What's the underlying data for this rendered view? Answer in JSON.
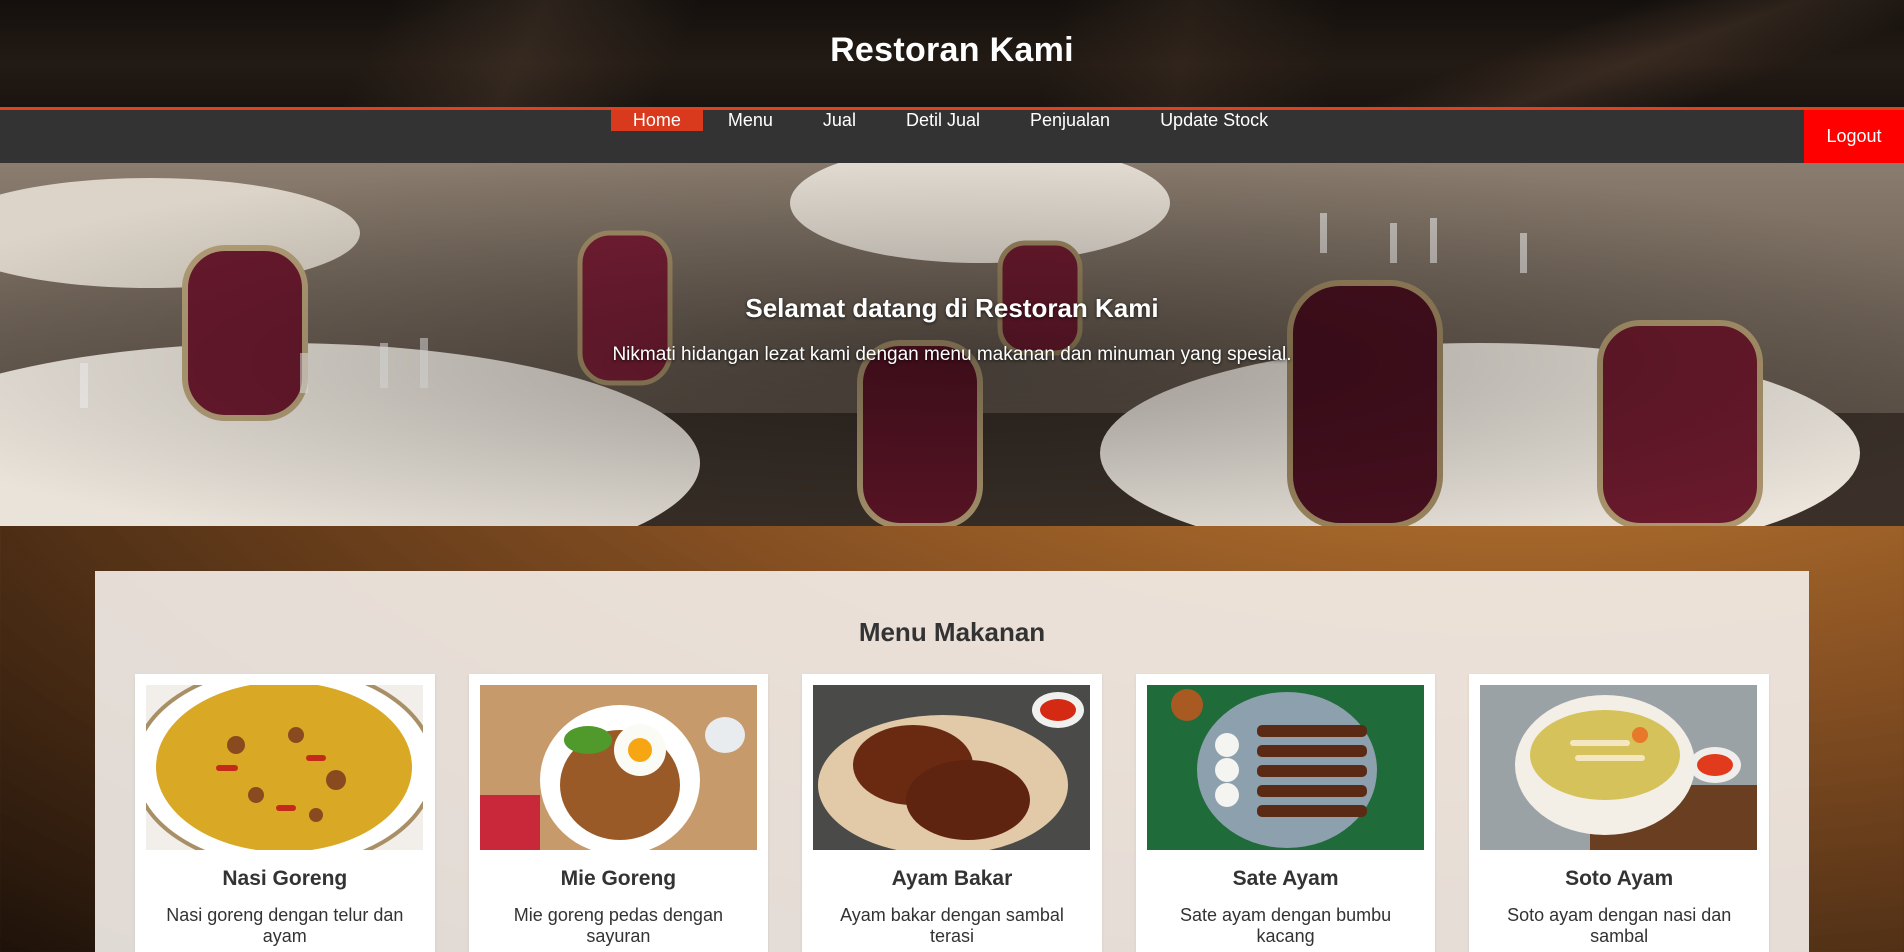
{
  "site": {
    "title": "Restoran Kami"
  },
  "nav": {
    "items": [
      {
        "label": "Home",
        "active": true
      },
      {
        "label": "Menu"
      },
      {
        "label": "Jual"
      },
      {
        "label": "Detil Jual"
      },
      {
        "label": "Penjualan"
      },
      {
        "label": "Update Stock"
      }
    ],
    "logout_label": "Logout"
  },
  "hero": {
    "title": "Selamat datang di Restoran Kami",
    "subtitle": "Nikmati hidangan lezat kami dengan menu makanan dan minuman yang spesial."
  },
  "menu": {
    "title": "Menu Makanan",
    "items": [
      {
        "name": "Nasi Goreng",
        "desc": "Nasi goreng dengan telur dan ayam"
      },
      {
        "name": "Mie Goreng",
        "desc": "Mie goreng pedas dengan sayuran"
      },
      {
        "name": "Ayam Bakar",
        "desc": "Ayam bakar dengan sambal terasi"
      },
      {
        "name": "Sate Ayam",
        "desc": "Sate ayam dengan bumbu kacang"
      },
      {
        "name": "Soto Ayam",
        "desc": "Soto ayam dengan nasi dan sambal"
      }
    ]
  },
  "colors": {
    "header_accent": "#e0411f",
    "nav_bg": "#333333",
    "nav_active": "#d9391c",
    "logout_bg": "#ff0000"
  }
}
